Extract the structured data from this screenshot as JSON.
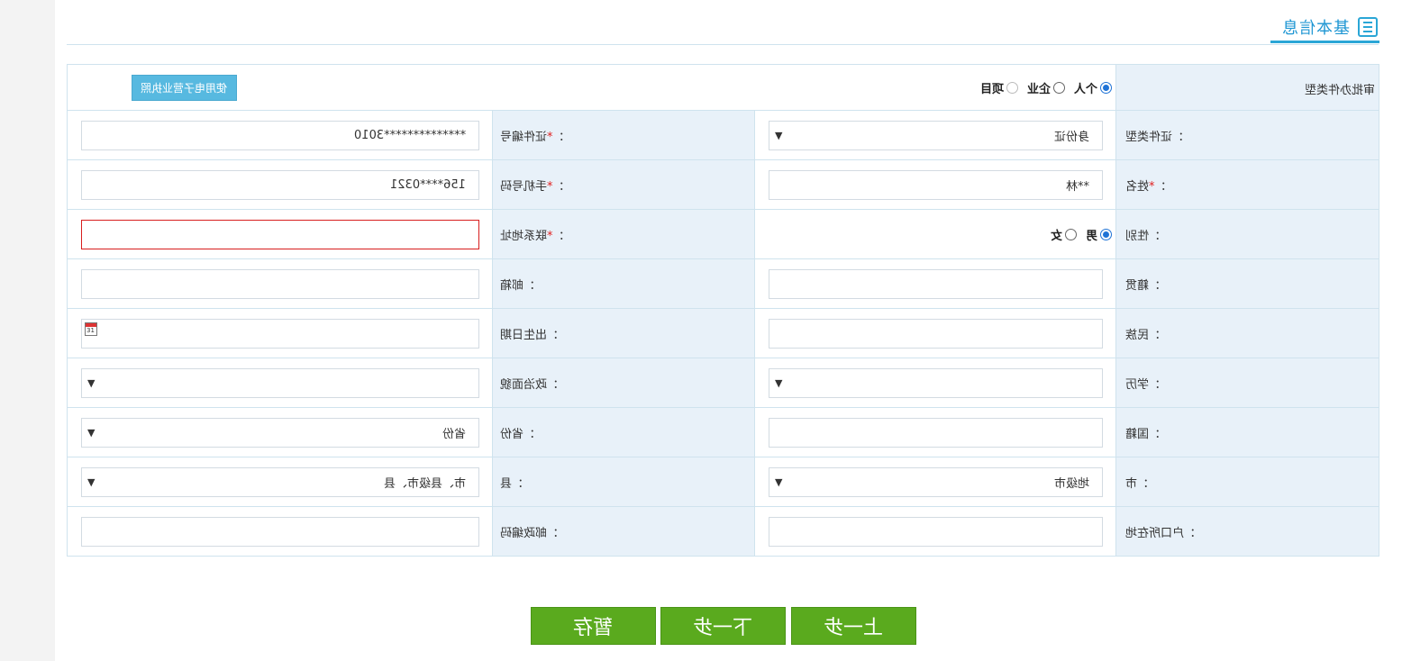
{
  "header": {
    "title": "基本信息",
    "icon": "list-icon"
  },
  "form": {
    "apply_type": {
      "label": "审批办件类型",
      "options": [
        {
          "label": "个人",
          "checked": true
        },
        {
          "label": "企业",
          "checked": false
        },
        {
          "label": "项目",
          "checked": false
        }
      ],
      "license_button": "使用电子营业执照"
    },
    "id_type": {
      "label": "证件类型",
      "value": "身份证"
    },
    "id_number": {
      "label": "*证件编号",
      "value": "**************3010"
    },
    "name": {
      "label": "*姓名",
      "value": "**林"
    },
    "mobile": {
      "label": "*手机号码",
      "value": "156****0321"
    },
    "gender": {
      "label": "性别",
      "options": [
        {
          "label": "男",
          "checked": true
        },
        {
          "label": "女",
          "checked": false
        }
      ]
    },
    "address": {
      "label": "*联系地址",
      "value": ""
    },
    "native_place": {
      "label": "籍贯",
      "value": ""
    },
    "email": {
      "label": "邮箱",
      "value": ""
    },
    "ethnicity": {
      "label": "民族",
      "value": ""
    },
    "birth_date": {
      "label": "出生日期",
      "value": "",
      "calendar_icon_text": "31"
    },
    "education": {
      "label": "学历",
      "value": ""
    },
    "political_status": {
      "label": "政治面貌",
      "value": ""
    },
    "nationality": {
      "label": "国籍",
      "value": ""
    },
    "province": {
      "label": "省份",
      "value": "省份"
    },
    "city": {
      "label": "市",
      "value": "地级市"
    },
    "county": {
      "label": "县",
      "value": "市、县级市、县"
    },
    "household_location": {
      "label": "户口所在地",
      "value": ""
    },
    "postal_code": {
      "label": "邮政编码",
      "value": ""
    },
    "colon": "："
  },
  "buttons": {
    "prev": "上一步",
    "next": "下一步",
    "save_draft": "暂存"
  },
  "colors": {
    "accent_blue": "#2aa6d6",
    "button_green": "#5aaa1e",
    "label_bg": "#e8f1f9",
    "error_red": "#d81e1e"
  }
}
